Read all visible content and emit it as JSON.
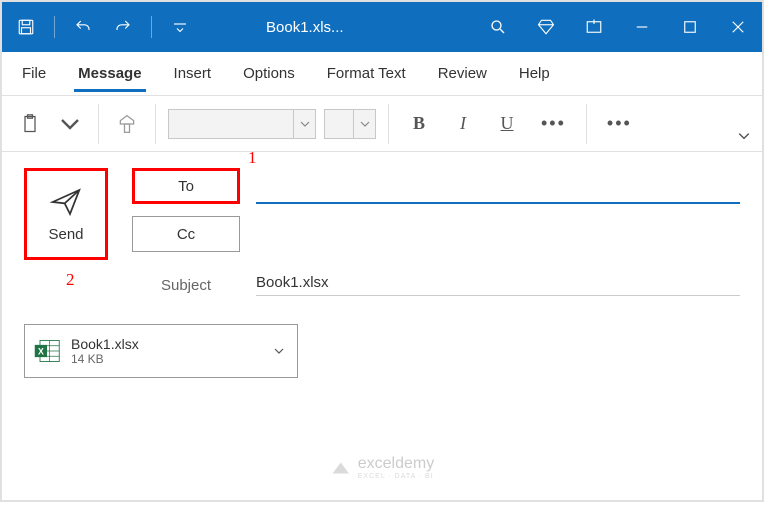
{
  "titlebar": {
    "title": "Book1.xls..."
  },
  "ribbon": {
    "tabs": {
      "file": "File",
      "message": "Message",
      "insert": "Insert",
      "options": "Options",
      "formatText": "Format Text",
      "review": "Review",
      "help": "Help"
    }
  },
  "compose": {
    "sendLabel": "Send",
    "toLabel": "To",
    "ccLabel": "Cc",
    "subjectLabel": "Subject",
    "subjectValue": "Book1.xlsx"
  },
  "attachment": {
    "name": "Book1.xlsx",
    "size": "14 KB"
  },
  "callouts": {
    "one": "1",
    "two": "2"
  },
  "watermark": {
    "brand": "exceldemy",
    "tagline": "EXCEL · DATA · BI"
  }
}
